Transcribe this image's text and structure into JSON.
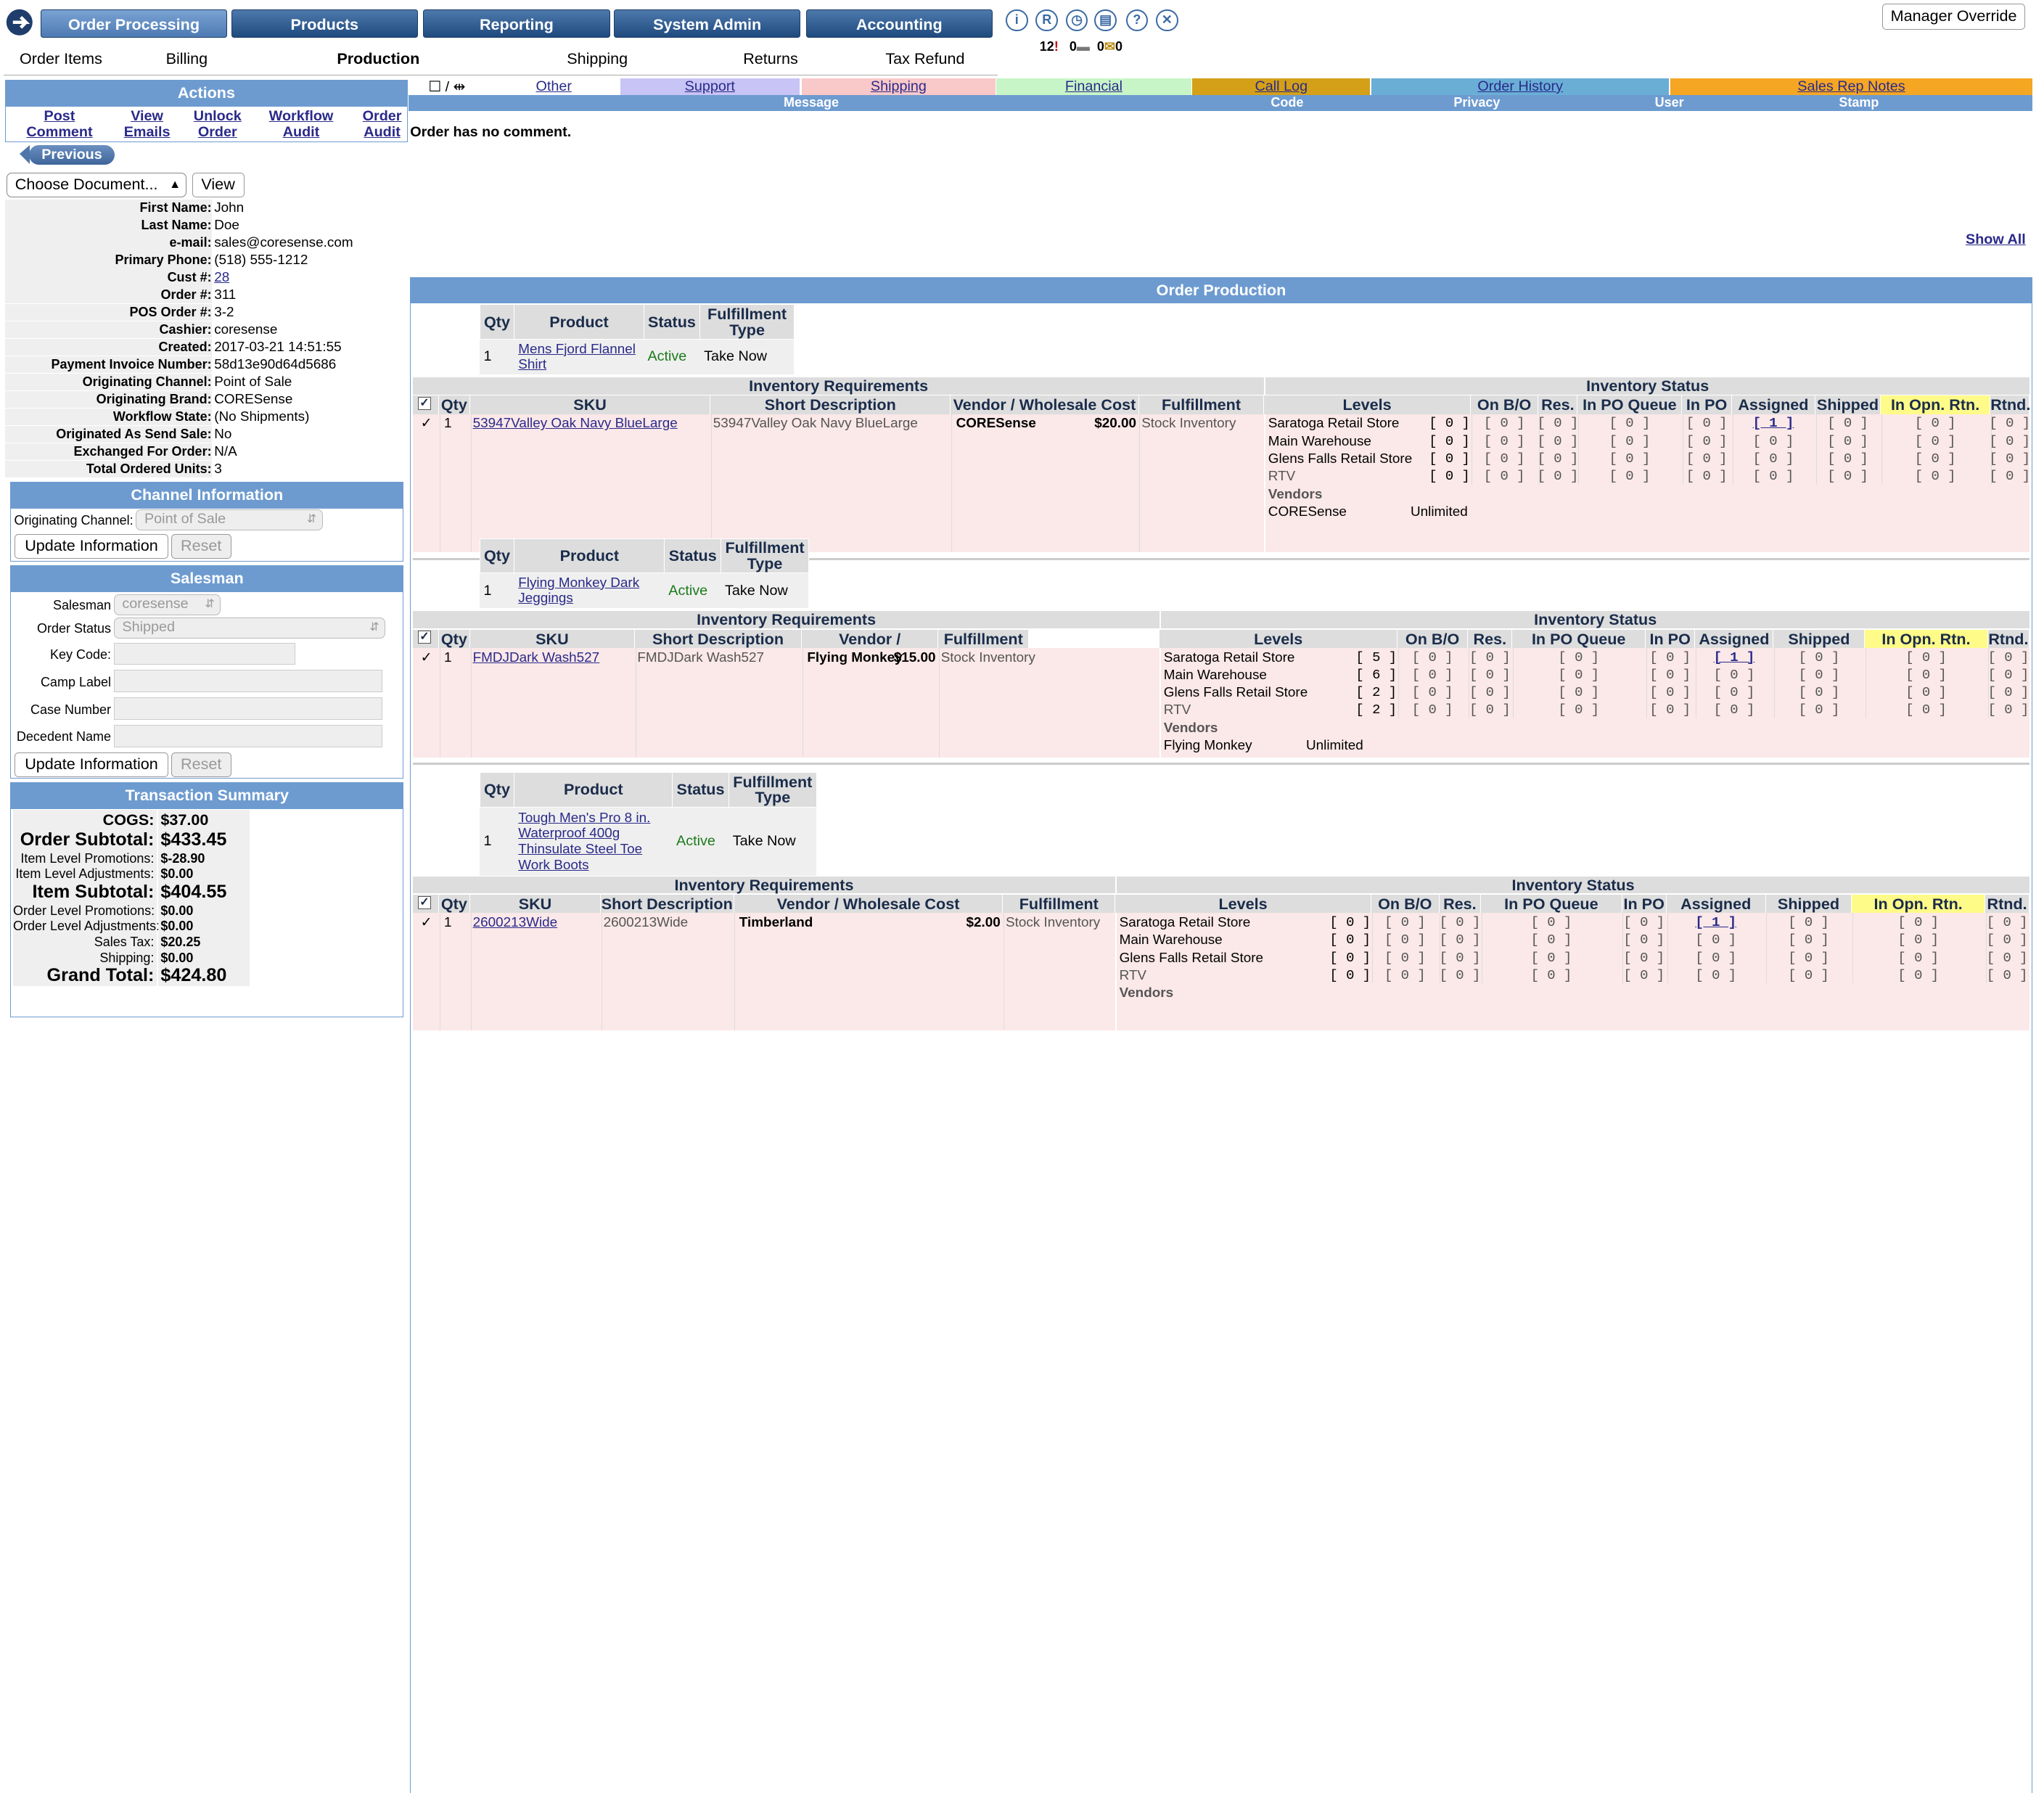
{
  "nav": {
    "tabs": [
      "Order Processing",
      "Products",
      "Reporting",
      "System Admin",
      "Accounting"
    ],
    "active_tab": 0,
    "subtabs": [
      "Order Items",
      "Billing",
      "Production",
      "Shipping",
      "Returns",
      "Tax Refund"
    ],
    "active_subtab": 2,
    "icons": [
      "info-icon",
      "registered-icon",
      "clock-icon",
      "print-icon",
      "help-icon",
      "close-icon"
    ],
    "counts": {
      "alerts": "12",
      "comments": "0",
      "mail": "0",
      "mail2": "0"
    },
    "manager_override": "Manager Override"
  },
  "actions": {
    "title": "Actions",
    "links": [
      {
        "l1": "Post",
        "l2": "Comment"
      },
      {
        "l1": "View",
        "l2": "Emails"
      },
      {
        "l1": "Unlock",
        "l2": "Order"
      },
      {
        "l1": "Workflow",
        "l2": "Audit"
      },
      {
        "l1": "Order",
        "l2": "Audit"
      }
    ],
    "previous": "Previous",
    "document_select": "Choose Document...",
    "view": "View"
  },
  "customer": [
    {
      "label": "First Name:",
      "value": "John"
    },
    {
      "label": "Last Name:",
      "value": "Doe"
    },
    {
      "label": "e-mail:",
      "value": "sales@coresense.com"
    },
    {
      "label": "Primary Phone:",
      "value": "(518) 555-1212"
    },
    {
      "label": "Cust #:",
      "value": "28",
      "link": true
    },
    {
      "label": "Order #:",
      "value": "311"
    },
    {
      "label": "POS Order #:",
      "value": "3-2"
    },
    {
      "label": "Cashier:",
      "value": "coresense"
    },
    {
      "label": "Created:",
      "value": "2017-03-21 14:51:55"
    },
    {
      "label": "Payment Invoice Number:",
      "value": "58d13e90d64d5686"
    },
    {
      "label": "Originating Channel:",
      "value": "Point of Sale"
    },
    {
      "label": "Originating Brand:",
      "value": "CORESense"
    },
    {
      "label": "Workflow State:",
      "value": "(No Shipments)"
    },
    {
      "label": "Originated As Send Sale:",
      "value": "No"
    },
    {
      "label": "Exchanged For Order:",
      "value": "N/A"
    },
    {
      "label": "Total Ordered Units:",
      "value": "3"
    }
  ],
  "channel": {
    "title": "Channel Information",
    "label": "Originating Channel:",
    "value": "Point of Sale",
    "update": "Update Information",
    "reset": "Reset"
  },
  "salesman": {
    "title": "Salesman",
    "salesman_label": "Salesman",
    "salesman_value": "coresense",
    "status_label": "Order Status",
    "status_value": "Shipped",
    "key_code": "Key Code:",
    "camp_label": "Camp Label",
    "case_number": "Case Number",
    "decedent_name": "Decedent Name",
    "update": "Update Information",
    "reset": "Reset"
  },
  "summary": {
    "title": "Transaction Summary",
    "rows": [
      {
        "label": "COGS:",
        "value": "$37.00",
        "size": "med"
      },
      {
        "label": "Order Subtotal:",
        "value": "$433.45",
        "size": "big"
      },
      {
        "label": "Item Level Promotions:",
        "value": "$-28.90",
        "size": "small"
      },
      {
        "label": "Item Level Adjustments:",
        "value": "$0.00",
        "size": "small"
      },
      {
        "label": "Item Subtotal:",
        "value": "$404.55",
        "size": "big"
      },
      {
        "label": "Order Level Promotions:",
        "value": "$0.00",
        "size": "small"
      },
      {
        "label": "Order Level Adjustments:",
        "value": "$0.00",
        "size": "small"
      },
      {
        "label": "Sales Tax:",
        "value": "$20.25",
        "size": "small"
      },
      {
        "label": "Shipping:",
        "value": "$0.00",
        "size": "small"
      },
      {
        "label": "Grand Total:",
        "value": "$424.80",
        "size": "big"
      }
    ]
  },
  "comments": {
    "tabs": [
      {
        "label": "Other",
        "color": "#ffffff"
      },
      {
        "label": "Support",
        "color": "#c8c4f5"
      },
      {
        "label": "Shipping",
        "color": "#f9c8c8"
      },
      {
        "label": "Financial",
        "color": "#c8f5c8"
      },
      {
        "label": "Call Log",
        "color": "#d4a017"
      },
      {
        "label": "Order History",
        "color": "#6aaed6"
      },
      {
        "label": "Sales Rep Notes",
        "color": "#f5a623"
      }
    ],
    "columns": [
      "Message",
      "Code",
      "Privacy",
      "User",
      "Stamp"
    ],
    "empty": "Order has no comment.",
    "show_all": "Show All"
  },
  "production": {
    "title": "Order Production",
    "product_headers": [
      "Qty",
      "Product",
      "Status",
      "Fulfillment Type"
    ],
    "req_title": "Inventory Requirements",
    "status_title": "Inventory Status",
    "req_headers": [
      "Qty",
      "SKU",
      "Short Description",
      "Vendor / Wholesale Cost",
      "Fulfillment"
    ],
    "status_headers": [
      "Levels",
      "On B/O",
      "Res.",
      "In PO Queue",
      "In PO",
      "Assigned",
      "Shipped",
      "In Opn. Rtn.",
      "Rtnd."
    ],
    "vendors_label": "Vendors",
    "items": [
      {
        "qty": "1",
        "product": "Mens Fjord Flannel Shirt",
        "status": "Active",
        "fulfillment_type": "Take Now",
        "sku": "53947Valley Oak Navy BlueLarge",
        "short_desc": "53947Valley Oak Navy BlueLarge",
        "vendor": "CORESense",
        "cost": "$20.00",
        "fulfillment": "Stock Inventory",
        "levels": [
          {
            "name": "Saratoga Retail Store",
            "qty": "[ 0 ]",
            "assigned": "[ 1 ]"
          },
          {
            "name": "Main Warehouse",
            "qty": "[ 0 ]",
            "assigned": "[ 0 ]"
          },
          {
            "name": "Glens Falls Retail Store",
            "qty": "[ 0 ]",
            "assigned": "[ 0 ]"
          },
          {
            "name": "RTV",
            "qty": "[ 0 ]",
            "assigned": "[ 0 ]"
          }
        ],
        "vendor_name": "CORESense",
        "vendor_qty": "Unlimited"
      },
      {
        "qty": "1",
        "product": "Flying Monkey Dark Jeggings",
        "status": "Active",
        "fulfillment_type": "Take Now",
        "sku": "FMDJDark Wash527",
        "short_desc": "FMDJDark Wash527",
        "vendor": "Flying Monkey",
        "cost": "$15.00",
        "fulfillment": "Stock Inventory",
        "levels": [
          {
            "name": "Saratoga Retail Store",
            "qty": "[ 5 ]",
            "assigned": "[ 1 ]"
          },
          {
            "name": "Main Warehouse",
            "qty": "[ 6 ]",
            "assigned": "[ 0 ]"
          },
          {
            "name": "Glens Falls Retail Store",
            "qty": "[ 2 ]",
            "assigned": "[ 0 ]"
          },
          {
            "name": "RTV",
            "qty": "[ 2 ]",
            "assigned": "[ 0 ]"
          }
        ],
        "vendor_name": "Flying Monkey",
        "vendor_qty": "Unlimited"
      },
      {
        "qty": "1",
        "product": "Tough Men's Pro 8 in. Waterproof 400g Thinsulate Steel Toe Work Boots",
        "status": "Active",
        "fulfillment_type": "Take Now",
        "sku": "2600213Wide",
        "short_desc": "2600213Wide",
        "vendor": "Timberland",
        "cost": "$2.00",
        "fulfillment": "Stock Inventory",
        "levels": [
          {
            "name": "Saratoga Retail Store",
            "qty": "[ 0 ]",
            "assigned": "[ 1 ]"
          },
          {
            "name": "Main Warehouse",
            "qty": "[ 0 ]",
            "assigned": "[ 0 ]"
          },
          {
            "name": "Glens Falls Retail Store",
            "qty": "[ 0 ]",
            "assigned": "[ 0 ]"
          },
          {
            "name": "RTV",
            "qty": "[ 0 ]",
            "assigned": "[ 0 ]"
          }
        ],
        "vendor_name": "",
        "vendor_qty": ""
      }
    ],
    "zero": "[ 0 ]"
  }
}
